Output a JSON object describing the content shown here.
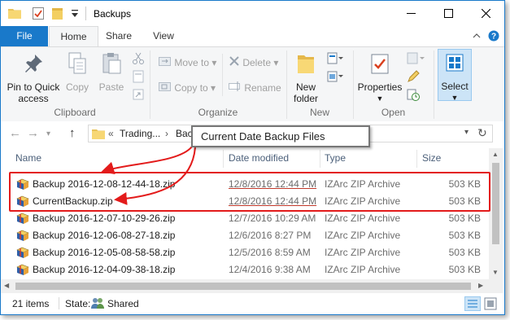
{
  "window": {
    "title": "Backups",
    "controls": {
      "minimize": "minimize",
      "maximize": "maximize",
      "close": "close"
    }
  },
  "ribbon_tabs": [
    "File",
    "Home",
    "Share",
    "View"
  ],
  "ribbon": {
    "clipboard": {
      "label": "Clipboard",
      "pin": "Pin to Quick access",
      "pin_line1": "Pin to Quick",
      "pin_line2": "access",
      "copy": "Copy",
      "paste": "Paste"
    },
    "organize": {
      "label": "Organize",
      "move_to": "Move to",
      "copy_to": "Copy to",
      "delete": "Delete",
      "rename": "Rename"
    },
    "new": {
      "label": "New",
      "new_folder_line1": "New",
      "new_folder_line2": "folder"
    },
    "open": {
      "label": "Open",
      "properties": "Properties"
    },
    "select": {
      "label": "Select"
    }
  },
  "address": {
    "crumb_prefix": "«",
    "crumb1": "Trading...",
    "crumb2": "Backups"
  },
  "columns": {
    "name": "Name",
    "date": "Date modified",
    "type": "Type",
    "size": "Size"
  },
  "files": [
    {
      "name": "Backup 2016-12-08-12-44-18.zip",
      "date": "12/8/2016 12:44 PM",
      "type": "IZArc ZIP Archive",
      "size": "503 KB",
      "highlight": true
    },
    {
      "name": "CurrentBackup.zip",
      "date": "12/8/2016 12:44 PM",
      "type": "IZArc ZIP Archive",
      "size": "503 KB",
      "highlight": true
    },
    {
      "name": "Backup 2016-12-07-10-29-26.zip",
      "date": "12/7/2016 10:29 AM",
      "type": "IZArc ZIP Archive",
      "size": "503 KB",
      "highlight": false
    },
    {
      "name": "Backup 2016-12-06-08-27-18.zip",
      "date": "12/6/2016 8:27 PM",
      "type": "IZArc ZIP Archive",
      "size": "503 KB",
      "highlight": false
    },
    {
      "name": "Backup 2016-12-05-08-58-58.zip",
      "date": "12/5/2016 8:59 AM",
      "type": "IZArc ZIP Archive",
      "size": "503 KB",
      "highlight": false
    },
    {
      "name": "Backup 2016-12-04-09-38-18.zip",
      "date": "12/4/2016 9:38 AM",
      "type": "IZArc ZIP Archive",
      "size": "503 KB",
      "highlight": false
    }
  ],
  "status": {
    "items": "21 items",
    "state_label": "State:",
    "state_value": "Shared"
  },
  "annotation": {
    "callout": "Current Date Backup Files",
    "color": "#e31b1b"
  },
  "colors": {
    "accent": "#1979ca",
    "ribbon_bg": "#f5f6f7",
    "header_text": "#4c607a"
  }
}
